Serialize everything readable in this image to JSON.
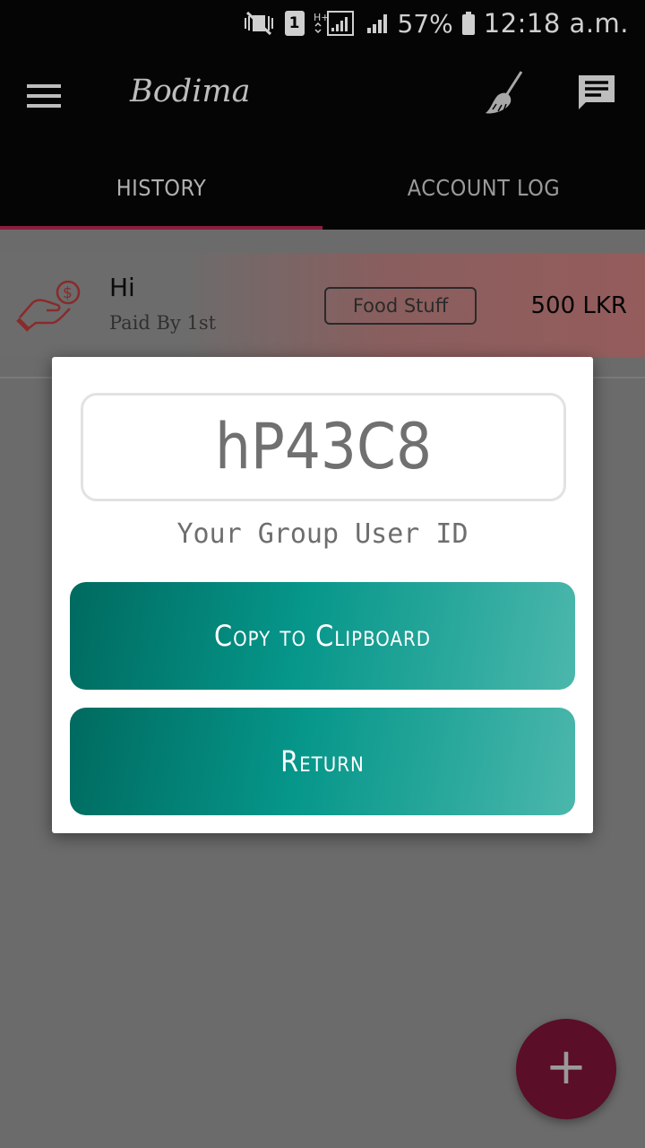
{
  "status_bar": {
    "battery": "57%",
    "time": "12:18 a.m.",
    "sim_slot": "1",
    "network": "H+"
  },
  "app_bar": {
    "title": "Bodima",
    "icons": [
      "menu-icon",
      "broom-icon",
      "chat-icon"
    ]
  },
  "tabs": [
    {
      "label": "HISTORY",
      "active": true
    },
    {
      "label": "ACCOUNT LOG",
      "active": false
    }
  ],
  "history_item": {
    "title": "Hi",
    "subtitle": "Paid By 1st",
    "category": "Food Stuff",
    "amount": "500 LKR",
    "icon": "payment-hand-icon"
  },
  "dialog": {
    "user_id": "hP43C8",
    "label": "Your Group User ID",
    "copy_button": "Copy to Clipboard",
    "return_button": "Return"
  },
  "fab": {
    "symbol": "+"
  },
  "colors": {
    "accent": "#8a1e3e",
    "button_teal": "#06968a",
    "fab": "#5a0e28"
  }
}
